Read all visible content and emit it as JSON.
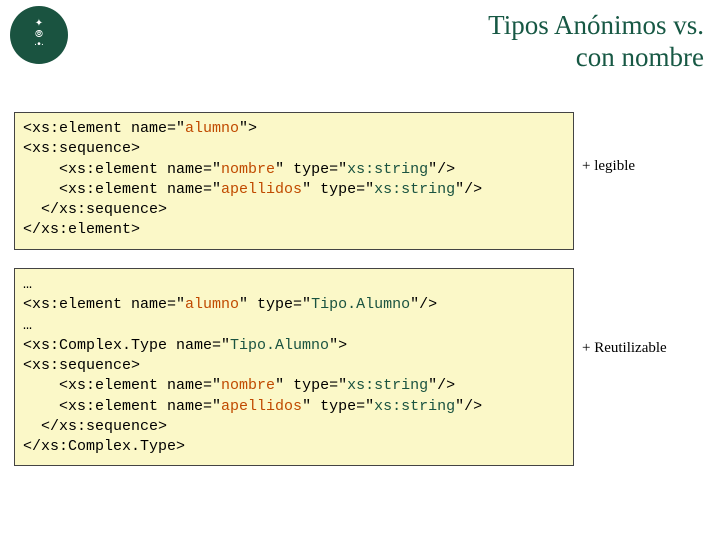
{
  "title_line1": "Tipos Anónimos vs.",
  "title_line2": "con nombre",
  "logo_alt": "universidad",
  "caption1": "+ legible",
  "caption2": "+ Reutilizable",
  "code1": {
    "l1a": "<xs:element name=\"",
    "l1b": "alumno",
    "l1c": "\">",
    "l2": "<xs:sequence>",
    "l3a": "    <xs:element name=\"",
    "l3b": "nombre",
    "l3c": "\" type=\"",
    "l3d": "xs:string",
    "l3e": "\"/>",
    "l4a": "    <xs:element name=\"",
    "l4b": "apellidos",
    "l4c": "\" type=\"",
    "l4d": "xs:string",
    "l4e": "\"/>",
    "l5": "  </xs:sequence>",
    "l6": "</xs:element>"
  },
  "code2": {
    "l0": "…",
    "l1a": "<xs:element name=\"",
    "l1b": "alumno",
    "l1c": "\" type=\"",
    "l1d": "Tipo.Alumno",
    "l1e": "\"/>",
    "l2": "…",
    "l3a": "<xs:Complex.Type name=\"",
    "l3b": "Tipo.Alumno",
    "l3c": "\">",
    "l4": "<xs:sequence>",
    "l5a": "    <xs:element name=\"",
    "l5b": "nombre",
    "l5c": "\" type=\"",
    "l5d": "xs:string",
    "l5e": "\"/>",
    "l6a": "    <xs:element name=\"",
    "l6b": "apellidos",
    "l6c": "\" type=\"",
    "l6d": "xs:string",
    "l6e": "\"/>",
    "l7": "  </xs:sequence>",
    "l8": "</xs:Complex.Type>"
  }
}
